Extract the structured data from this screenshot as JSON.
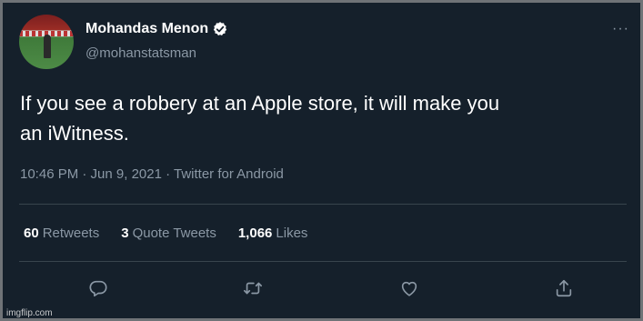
{
  "author": {
    "name": "Mohandas Menon",
    "handle": "@mohanstatsman",
    "verified": true
  },
  "tweet": {
    "text_line1": "If you see a robbery at an Apple store, it will make you",
    "text_line2": "an iWitness.",
    "meta": "10:46 PM · Jun 9, 2021 · Twitter for Android"
  },
  "stats": {
    "retweets_count": "60",
    "retweets_label": "Retweets",
    "quotes_count": "3",
    "quotes_label": "Quote Tweets",
    "likes_count": "1,066",
    "likes_label": "Likes"
  },
  "more_label": "···",
  "watermark": "imgflip.com",
  "colors": {
    "background": "#15202b",
    "text": "#ffffff",
    "secondary": "#8b98a5",
    "divider": "#38444d",
    "verified": "#ffffff"
  },
  "icons": [
    "verified-badge-icon",
    "more-icon",
    "reply-icon",
    "retweet-icon",
    "like-icon",
    "share-icon"
  ]
}
